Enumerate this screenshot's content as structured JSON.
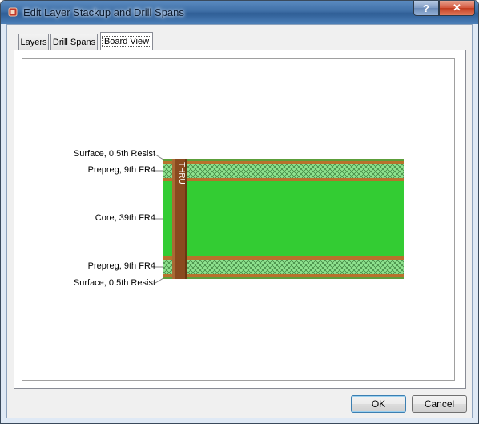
{
  "window": {
    "title": "Edit Layer Stackup and Drill Spans",
    "help_label": "?",
    "close_label": "✕",
    "title_icon": "app-icon"
  },
  "tabs": [
    {
      "label": "Layers",
      "active": false
    },
    {
      "label": "Drill Spans",
      "active": false
    },
    {
      "label": "Board View",
      "active": true
    }
  ],
  "board_view": {
    "layers": [
      {
        "label": "Surface, 0.5th Resist"
      },
      {
        "label": "Prepreg, 9th FR4"
      },
      {
        "label": "Core, 39th FR4"
      },
      {
        "label": "Prepreg, 9th FR4"
      },
      {
        "label": "Surface, 0.5th Resist"
      }
    ],
    "drill_label": "THRU",
    "colors": {
      "core": "#33cc33",
      "prepreg": "#8fe38f",
      "copper": "#b8722c",
      "drill": "#8a4a1f",
      "resist": "#5c9e3a"
    }
  },
  "buttons": {
    "ok_label": "OK",
    "cancel_label": "Cancel"
  }
}
